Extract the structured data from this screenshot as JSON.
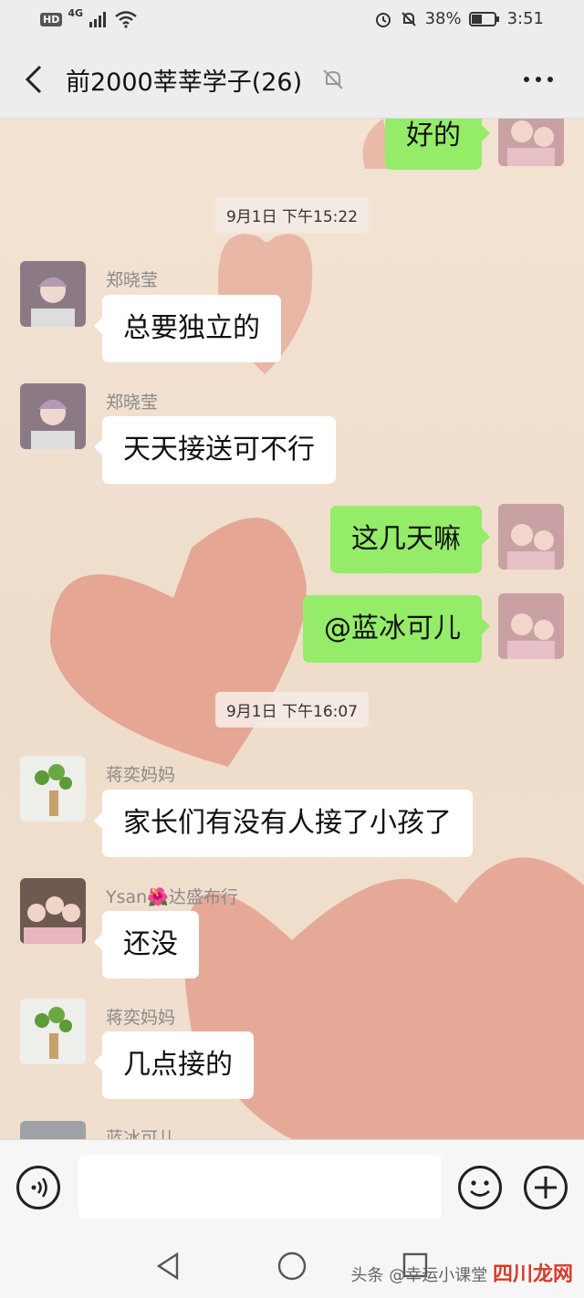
{
  "status_bar": {
    "hd": "HD",
    "network": "4G",
    "battery_percent": "38%",
    "time": "3:51"
  },
  "header": {
    "title": "前2000莘莘学子(26)"
  },
  "chat": {
    "top_partial_message": "好的",
    "timestamps": [
      "9月1日 下午15:22",
      "9月1日 下午16:07"
    ],
    "messages": [
      {
        "sender": "郑晓莹",
        "text": "总要独立的"
      },
      {
        "sender": "郑晓莹",
        "text": "天天接送可不行"
      },
      {
        "sender": "",
        "text": "这几天嘛"
      },
      {
        "sender": "",
        "text": "@蓝冰可儿"
      },
      {
        "sender": "蒋奕妈妈",
        "text": "家长们有没有人接了小孩了"
      },
      {
        "sender": "Ysan🌺达盛布行",
        "text": "还没"
      },
      {
        "sender": "蒋奕妈妈",
        "text": "几点接的"
      },
      {
        "sender": "蓝冰可儿",
        "text": ""
      }
    ]
  },
  "input_bar": {
    "voice_icon": "voice-icon",
    "emoji_icon": "emoji-icon",
    "plus_icon": "plus-icon"
  },
  "nav_bar": {
    "back": "triangle-back-icon",
    "home": "circle-home-icon",
    "recent": "square-recent-icon"
  },
  "watermark": {
    "prefix": "头条 @幸运小课堂",
    "brand": "四川龙网"
  },
  "colors": {
    "outgoing_bubble": "#95ec69",
    "incoming_bubble": "#ffffff",
    "heart": "#e4a08e"
  }
}
